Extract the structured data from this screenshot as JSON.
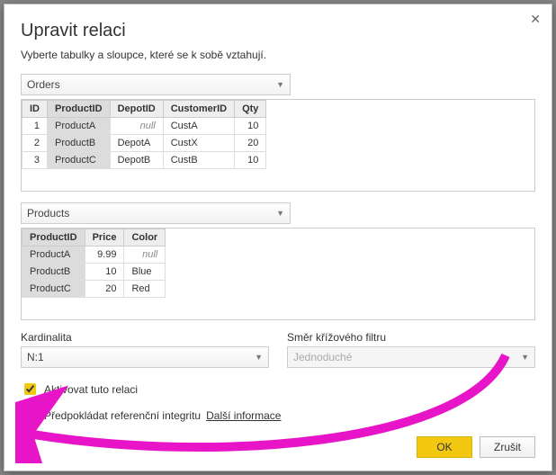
{
  "close_glyph": "✕",
  "title": "Upravit relaci",
  "subtitle": "Vyberte tabulky a sloupce, které se k sobě vztahují.",
  "table1": {
    "select": "Orders",
    "headers": [
      "ID",
      "ProductID",
      "DepotID",
      "CustomerID",
      "Qty"
    ],
    "rows": [
      {
        "id": "1",
        "product": "ProductA",
        "depot": "null",
        "customer": "CustA",
        "qty": "10"
      },
      {
        "id": "2",
        "product": "ProductB",
        "depot": "DepotA",
        "customer": "CustX",
        "qty": "20"
      },
      {
        "id": "3",
        "product": "ProductC",
        "depot": "DepotB",
        "customer": "CustB",
        "qty": "10"
      }
    ]
  },
  "table2": {
    "select": "Products",
    "headers": [
      "ProductID",
      "Price",
      "Color"
    ],
    "rows": [
      {
        "product": "ProductA",
        "price": "9.99",
        "color": "null"
      },
      {
        "product": "ProductB",
        "price": "10",
        "color": "Blue"
      },
      {
        "product": "ProductC",
        "price": "20",
        "color": "Red"
      }
    ]
  },
  "cardinality_label": "Kardinalita",
  "cardinality_value": "N:1",
  "crossfilter_label": "Směr křížového filtru",
  "crossfilter_value": "Jednoduché",
  "chk_activate": "Aktivovat tuto relaci",
  "chk_integrity": "Předpokládat referenční integritu",
  "more_info": "Další informace",
  "ok": "OK",
  "cancel": "Zrušit"
}
